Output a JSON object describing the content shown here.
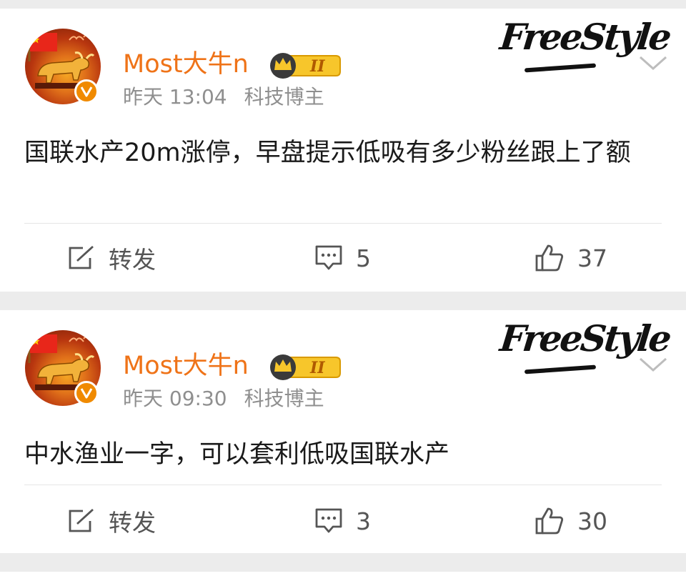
{
  "posts": [
    {
      "username": "Most大牛n",
      "level_badge": "II",
      "time": "昨天 13:04",
      "tag": "科技博主",
      "brand": "FreeStyle",
      "content": "国联水产20m涨停，早盘提示低吸有多少粉丝跟上了额",
      "repost_label": "转发",
      "comment_count": "5",
      "like_count": "37"
    },
    {
      "username": "Most大牛n",
      "level_badge": "II",
      "time": "昨天 09:30",
      "tag": "科技博主",
      "brand": "FreeStyle",
      "content": "中水渔业一字，可以套利低吸国联水产",
      "repost_label": "转发",
      "comment_count": "3",
      "like_count": "30"
    }
  ],
  "icons": {
    "verified": "verified-v-icon",
    "crown": "crown-badge-icon",
    "menu": "chevron-down-icon",
    "repost": "repost-icon",
    "comment": "comment-icon",
    "like": "thumbs-up-icon"
  },
  "colors": {
    "username": "#ef7318",
    "meta": "#8f8f8f",
    "background": "#ececec"
  }
}
